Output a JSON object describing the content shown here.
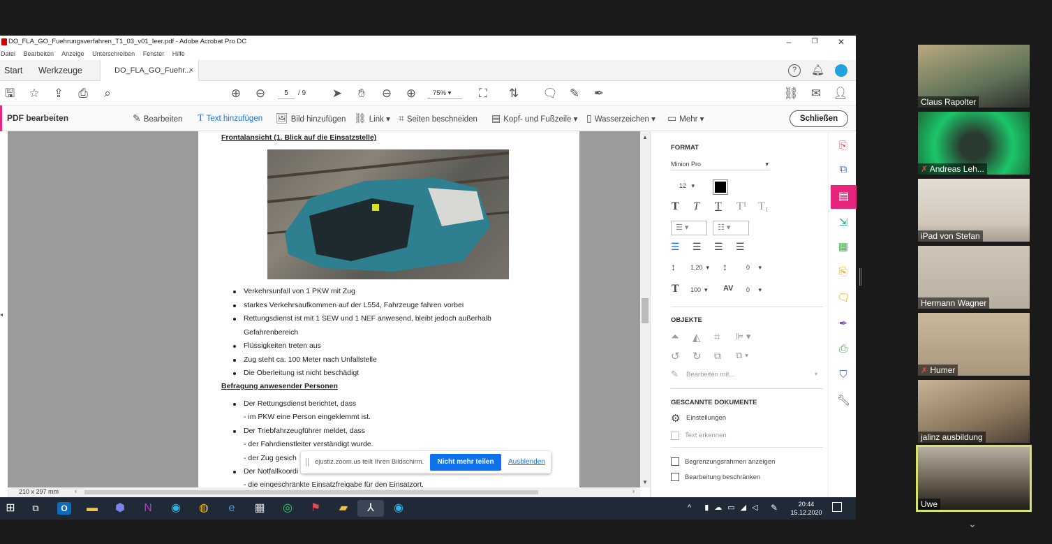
{
  "window": {
    "title": "DO_FLA_GO_Fuehrungsverfahren_T1_03_v01_leer.pdf - Adobe Acrobat Pro DC",
    "controls": [
      "–",
      "❐",
      "✕"
    ]
  },
  "menu": [
    "Datei",
    "Bearbeiten",
    "Anzeige",
    "Unterschreiben",
    "Fenster",
    "Hilfe"
  ],
  "tabs": {
    "home": "Start",
    "tools": "Werkzeuge",
    "document": "DO_FLA_GO_Fuehr...",
    "close": "×"
  },
  "toolbar": {
    "page_current": "5",
    "page_total": "/ 9",
    "zoom": "75%"
  },
  "edit_bar": {
    "label": "PDF bearbeiten",
    "items": [
      "Bearbeiten",
      "Text hinzufügen",
      "Bild hinzufügen",
      "Link",
      "Seiten beschneiden",
      "Kopf- und Fußzeile",
      "Wasserzeichen",
      "Mehr"
    ],
    "close": "Schließen"
  },
  "page": {
    "heading1": "Frontalansicht (1. Blick auf die Einsatzstelle)",
    "bullets1": [
      "Verkehrsunfall von 1 PKW mit Zug",
      "starkes Verkehrsaufkommen auf der L554, Fahrzeuge fahren vorbei",
      "Rettungsdienst ist mit 1 SEW und 1 NEF anwesend, bleibt jedoch außerhalb",
      "Gefahrenbereich",
      "Flüssigkeiten treten aus",
      "Zug steht ca. 100 Meter nach Unfallstelle",
      "Die Oberleitung ist nicht beschädigt"
    ],
    "heading2": "Befragung anwesender Personen",
    "bullets2": [
      "Der Rettungsdienst berichtet, dass",
      "- im PKW eine Person eingeklemmt ist.",
      "Der Triebfahrzeugführer meldet, dass",
      "- der Fahrdienstleiter verständigt wurde.",
      "- der Zug gesich",
      "Der Notfallkoordi",
      "- die eingeschränkte Einsatzfreigabe für den Einsatzort."
    ]
  },
  "status": {
    "page_size": "210 x 297 mm"
  },
  "format_panel": {
    "format_title": "FORMAT",
    "font": "Minion Pro",
    "font_size": "12",
    "line_spacing": "1,20",
    "para_spacing": "0",
    "scale": "100",
    "char_spacing": "0",
    "objects_title": "OBJEKTE",
    "edit_with": "Bearbeiten mit...",
    "scanned_title": "GESCANNTE DOKUMENTE",
    "settings": "Einstellungen",
    "recognize": "Text erkennen",
    "show_bounds": "Begrenzungsrahmen anzeigen",
    "restrict_edit": "Bearbeitung beschränken"
  },
  "share_bar": {
    "text": "ejustiz.zoom.us teilt Ihren Bildschirm.",
    "stop": "Nicht mehr teilen",
    "hide": "Ausblenden"
  },
  "taskbar": {
    "time": "20:44",
    "date": "15.12.2020"
  },
  "participants": [
    "Claus Rapolter",
    "Andreas Leh...",
    "iPad von Stefan",
    "Hermann Wagner",
    "Humer",
    "jalinz ausbildung",
    "Uwe"
  ],
  "colors": {
    "accent": "#0e72ed",
    "edit_pink": "#e6257c",
    "active_speaker": "#d6e36a"
  }
}
